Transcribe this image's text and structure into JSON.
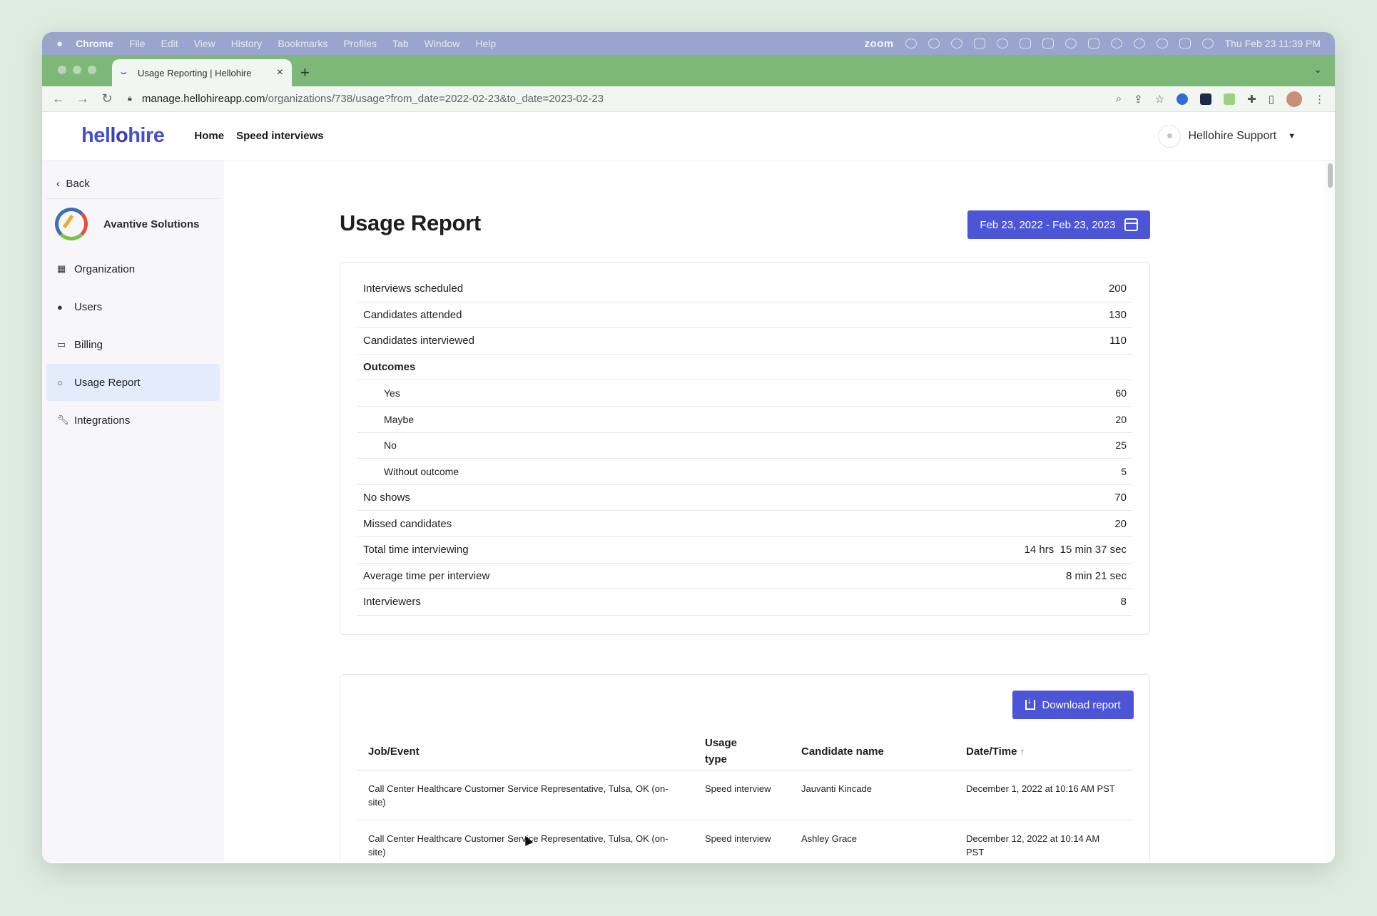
{
  "menubar": {
    "items": [
      "Chrome",
      "File",
      "Edit",
      "View",
      "History",
      "Bookmarks",
      "Profiles",
      "Tab",
      "Window",
      "Help"
    ],
    "zoom_label": "zoom",
    "clock": "Thu Feb 23  11:39 PM"
  },
  "browser": {
    "tab_title": "Usage Reporting | Hellohire",
    "tab_close": "×",
    "new_tab": "+",
    "url_domain": "manage.hellohireapp.com",
    "url_path": "/organizations/738/usage?from_date=2022-02-23&to_date=2023-02-23"
  },
  "header": {
    "logo_part1": "hel",
    "logo_part2": "lo",
    "logo_part3": "hire",
    "nav": [
      "Home",
      "Speed interviews"
    ],
    "user_name": "Hellohire Support"
  },
  "sidebar": {
    "back_label": "Back",
    "org_name": "Avantive Solutions",
    "items": [
      {
        "label": "Organization",
        "icon": "grid-icon"
      },
      {
        "label": "Users",
        "icon": "user-icon"
      },
      {
        "label": "Billing",
        "icon": "card-icon"
      },
      {
        "label": "Usage Report",
        "icon": "circle-icon",
        "active": true
      },
      {
        "label": "Integrations",
        "icon": "wrench-icon"
      }
    ]
  },
  "report": {
    "title": "Usage Report",
    "date_range": "Feb 23, 2022 - Feb 23, 2023",
    "stats": [
      {
        "label": "Interviews scheduled",
        "value": "200"
      },
      {
        "label": "Candidates attended",
        "value": "130"
      },
      {
        "label": "Candidates interviewed",
        "value": "110"
      },
      {
        "label": "Outcomes",
        "value": ""
      },
      {
        "label": "Yes",
        "value": "60"
      },
      {
        "label": "Maybe",
        "value": "20"
      },
      {
        "label": "No",
        "value": "25"
      },
      {
        "label": "Without outcome",
        "value": "5"
      },
      {
        "label": "No shows",
        "value": "70"
      },
      {
        "label": "Missed candidates",
        "value": "20"
      },
      {
        "label": "Total time interviewing",
        "value": "14 hrs  15 min 37 sec"
      },
      {
        "label": "Average time per interview",
        "value": "8 min 21 sec"
      },
      {
        "label": "Interviewers",
        "value": "8"
      }
    ],
    "download_label": "Download report",
    "table": {
      "headers": {
        "job": "Job/Event",
        "usage_type": "Usage type",
        "candidate": "Candidate name",
        "datetime": "Date/Time",
        "sort_arrow": "↑"
      },
      "rows": [
        {
          "job": "Call Center Healthcare Customer Service Representative, Tulsa, OK (on-site)",
          "usage_type": "Speed interview",
          "candidate": "Jauvanti Kincade",
          "datetime": "December 1, 2022 at 10:16 AM PST"
        },
        {
          "job": "Call Center Healthcare Customer Service Representative, Tulsa, OK (on-site)",
          "usage_type": "Speed interview",
          "candidate": "Ashley Grace",
          "datetime": "December 12, 2022 at 10:14 AM PST"
        }
      ]
    }
  }
}
